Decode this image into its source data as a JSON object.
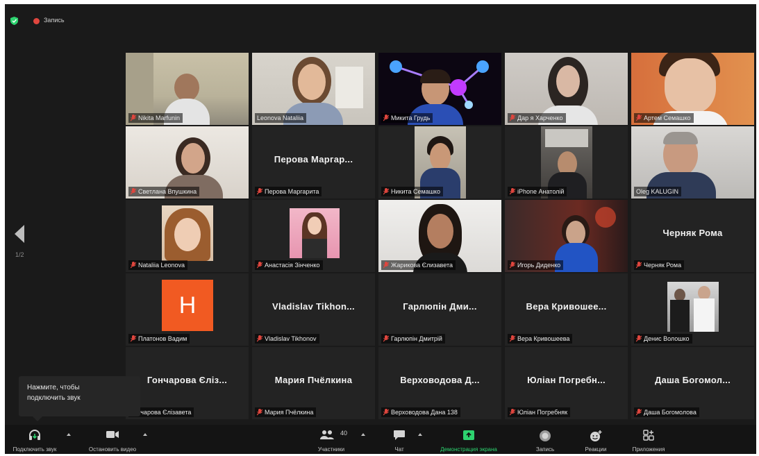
{
  "topbar": {
    "recording_label": "Запись"
  },
  "pager": {
    "indicator": "1/2"
  },
  "tooltip": {
    "line1": "Нажмите, чтобы",
    "line2": "подключить звук"
  },
  "tiles": [
    {
      "label": "Nikita Marfunin"
    },
    {
      "label": "Leonova Nataliia"
    },
    {
      "label": "Микита Грудь"
    },
    {
      "label": "Дар я Харченко"
    },
    {
      "label": "Артем Семашко"
    },
    {
      "label": "Светлана Впушкина"
    },
    {
      "label": "Перова Маргарита",
      "big": "Перова Маргар..."
    },
    {
      "label": "Никита Семашко"
    },
    {
      "label": "iPhone Анатолій"
    },
    {
      "label": "Oleg KALUGIN"
    },
    {
      "label": "Nataliia Leonova"
    },
    {
      "label": "Анастасія Зінченко"
    },
    {
      "label": "Жарикова Єлизавета"
    },
    {
      "label": "Игорь Диденко"
    },
    {
      "label": "Черняк Рома",
      "big": "Черняк Рома"
    },
    {
      "label": "Платонов Вадим",
      "avatar": "H"
    },
    {
      "label": "Vladislav Tikhonov",
      "big": "Vladislav Tikhon..."
    },
    {
      "label": "Гарлюпін Дмитрій",
      "big": "Гарлюпін Дми..."
    },
    {
      "label": "Вера Кривошеева",
      "big": "Вера Кривошее..."
    },
    {
      "label": "Денис Волошко"
    },
    {
      "label": "Гончарова Єлізавета",
      "big": "Гончарова Єліз..."
    },
    {
      "label": "Мария Пчёлкина",
      "big": "Мария Пчёлкина"
    },
    {
      "label": "Верховодова Дана 138",
      "big": "Верховодова Д..."
    },
    {
      "label": "Юліан Погребняк",
      "big": "Юліан Погребн..."
    },
    {
      "label": "Даша Богомолова",
      "big": "Даша Богомол..."
    }
  ],
  "toolbar": {
    "audio_label": "Подключить звук",
    "video_label": "Остановить видео",
    "participants_label": "Участники",
    "participants_count": "40",
    "chat_label": "Чат",
    "share_label": "Демонстрация экрана",
    "record_label": "Запись",
    "reactions_label": "Реакции",
    "apps_label": "Приложения"
  },
  "colors": {
    "background": "#1a1a1a",
    "toolbar": "#141414",
    "speaking_border": "#c9e36b",
    "muted_mic": "#e0463e",
    "share_green": "#2dd36f",
    "avatar_orange": "#f15a22"
  }
}
